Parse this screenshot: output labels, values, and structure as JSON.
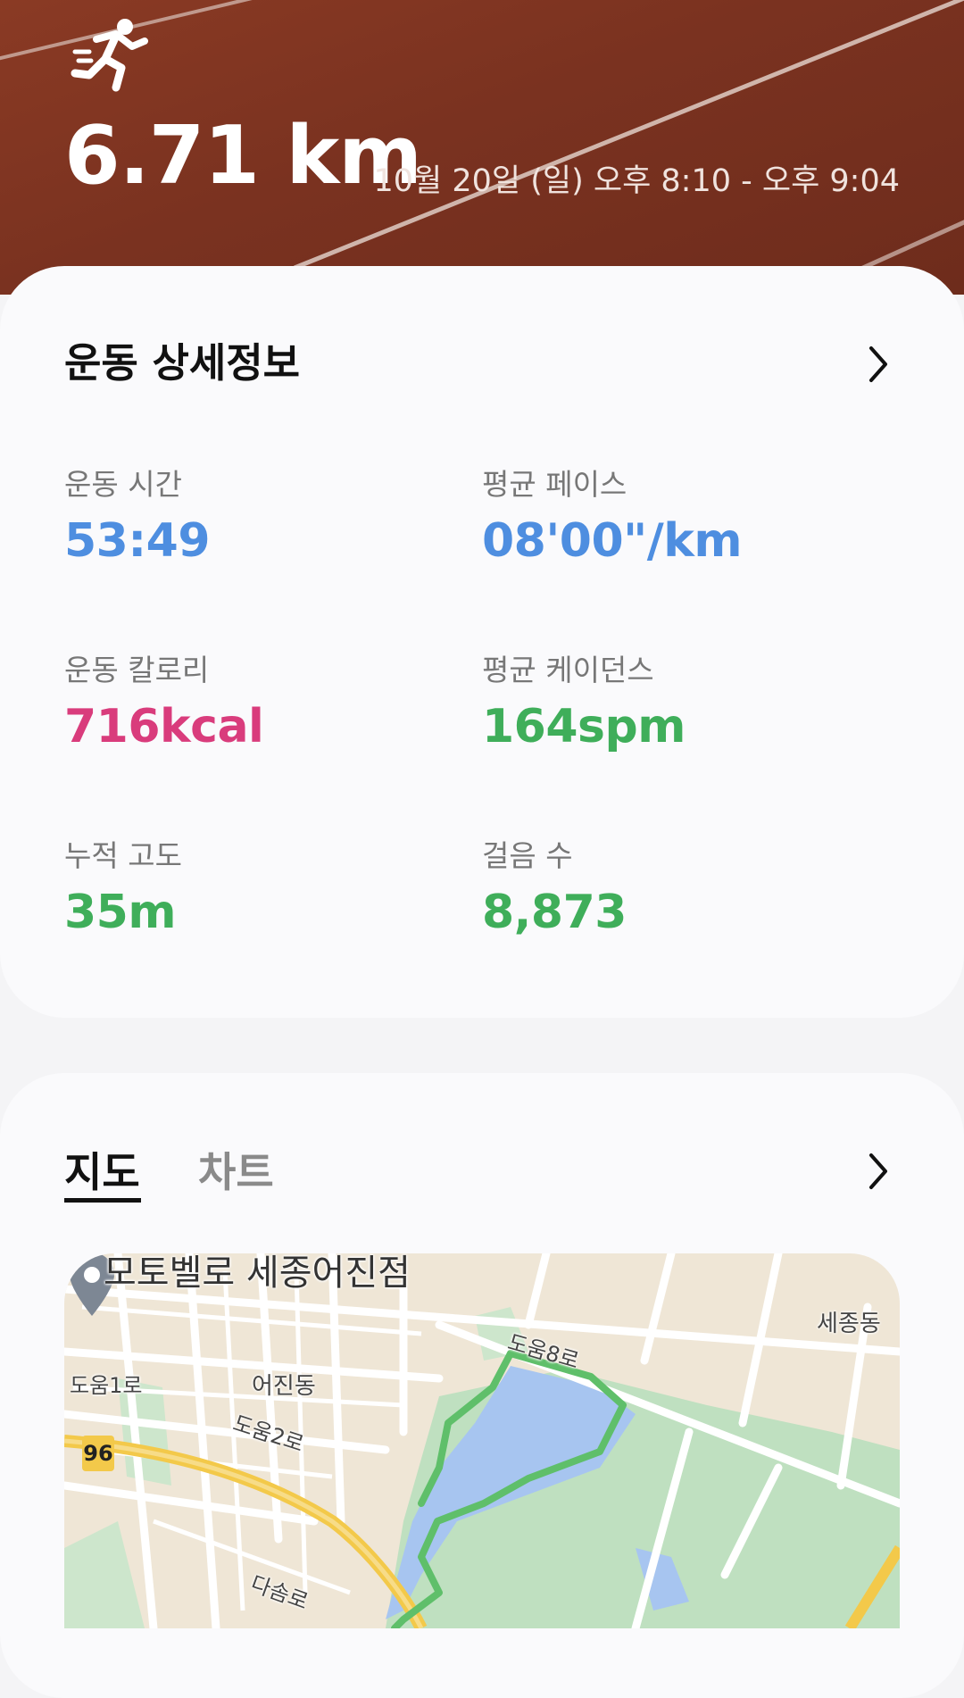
{
  "hero": {
    "distance": "6.71 km",
    "datetime": "10월 20일 (일) 오후 8:10 - 오후 9:04",
    "icon": "running-person-icon"
  },
  "details": {
    "title": "운동 상세정보",
    "stats": [
      {
        "label": "운동 시간",
        "value": "53:49",
        "color": "#4e8ee0"
      },
      {
        "label": "평균 페이스",
        "value": "08'00\"/km",
        "color": "#4e8ee0"
      },
      {
        "label": "운동 칼로리",
        "value": "716kcal",
        "color": "#d93c7c"
      },
      {
        "label": "평균 케이던스",
        "value": "164spm",
        "color": "#3fae5a"
      },
      {
        "label": "누적 고도",
        "value": "35m",
        "color": "#3fae5a"
      },
      {
        "label": "걸음 수",
        "value": "8,873",
        "color": "#3fae5a"
      }
    ]
  },
  "tabs": {
    "map_label": "지도",
    "chart_label": "차트"
  },
  "map": {
    "place_title": "모토벨로 세종어진점",
    "labels": {
      "doum8": "도움8로",
      "sejong": "세종동",
      "doum1": "도움1로",
      "eojin": "어진동",
      "doum2": "도움2로",
      "dasom": "다솜로"
    },
    "route_number": "96",
    "route_color": "#5fbf6a",
    "water_color": "#a7c5f0",
    "park_color": "#bfe0c0"
  }
}
